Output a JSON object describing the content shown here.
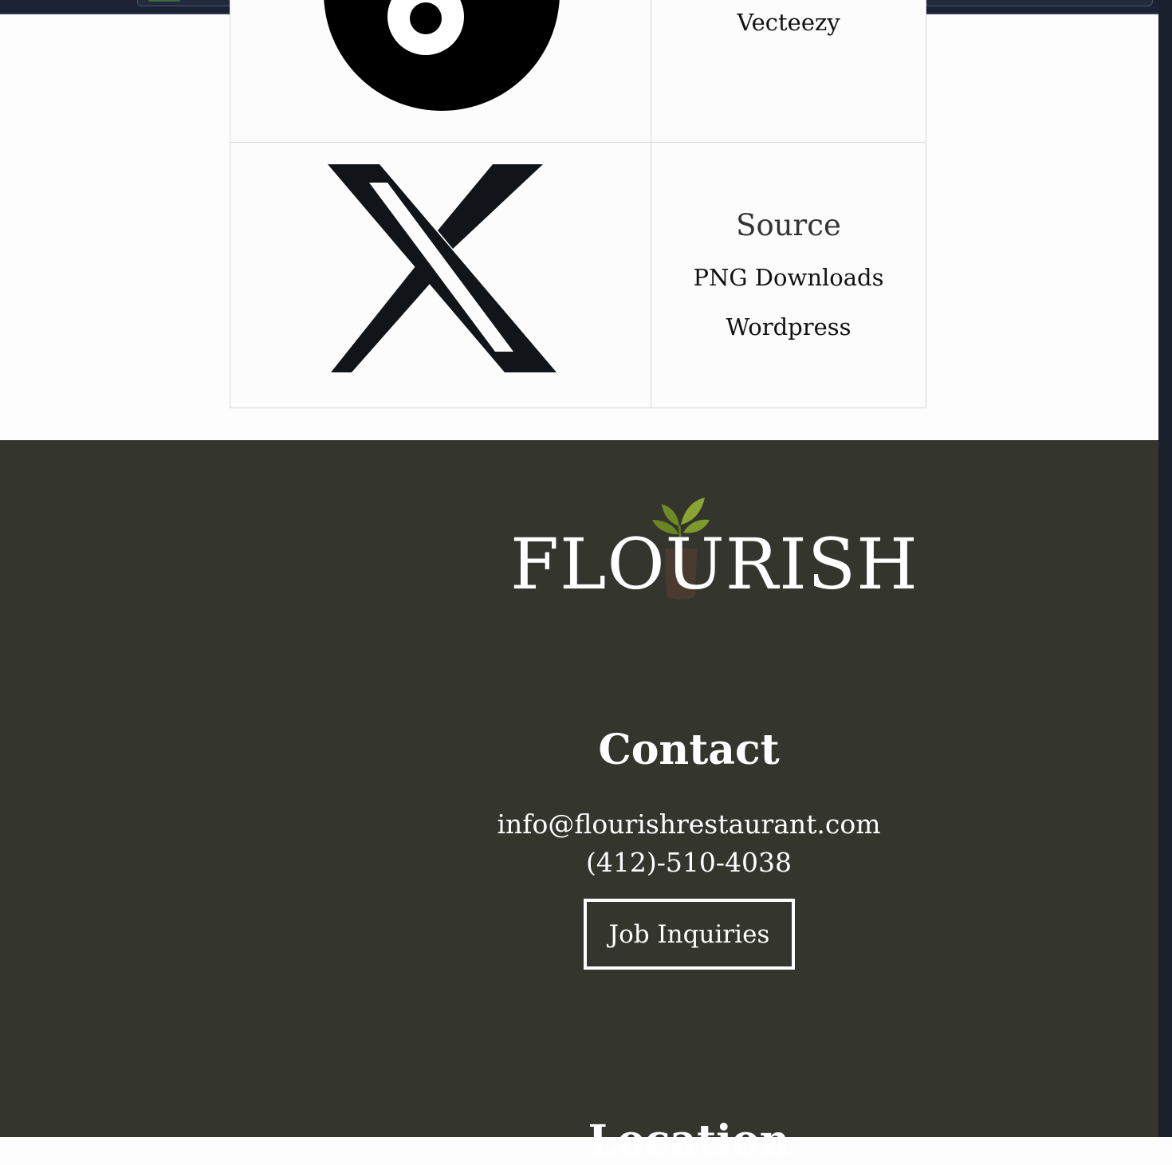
{
  "sources_table": {
    "rows": [
      {
        "icon": "threads-logo-icon",
        "text_lines": [
          "Vecteezy"
        ]
      },
      {
        "icon": "x-logo-icon",
        "heading": "Source",
        "text_lines": [
          "PNG Downloads",
          "Wordpress"
        ]
      }
    ]
  },
  "footer": {
    "logo_text": "FLOURISH",
    "contact": {
      "heading": "Contact",
      "email": "info@flourishrestaurant.com",
      "phone": "(412)-510-4038",
      "job_button": "Job Inquiries"
    },
    "next_heading_partial": "Location"
  },
  "colors": {
    "footer_bg": "#34362e",
    "leaf_green": "#7a8f2a",
    "soil_brown": "#4a3a30"
  }
}
